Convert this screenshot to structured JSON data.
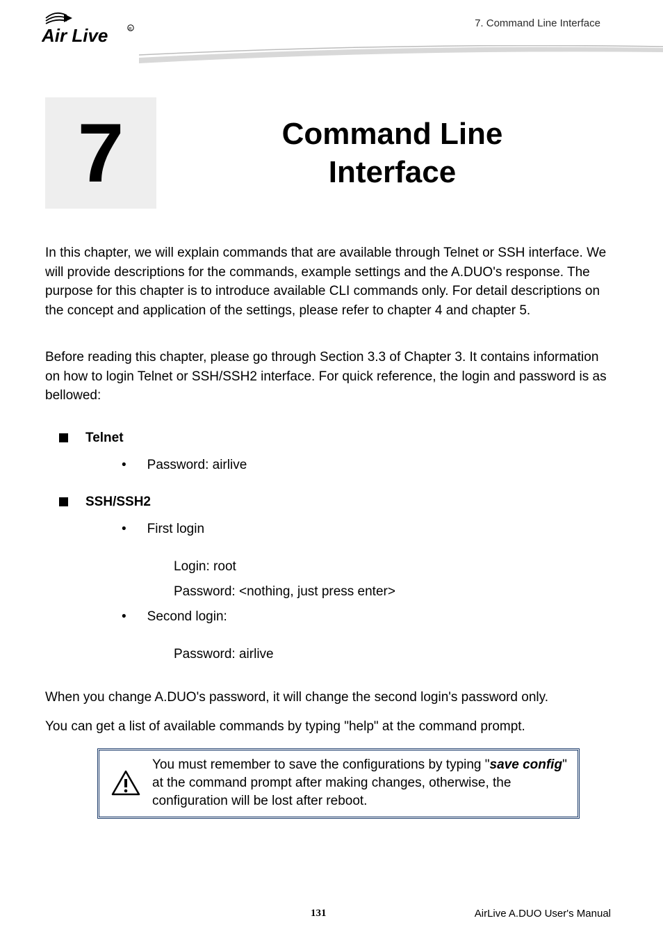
{
  "header": {
    "breadcrumb": "7. Command Line Interface"
  },
  "chapter": {
    "number": "7",
    "title_line1": "Command Line",
    "title_line2": "Interface"
  },
  "paragraphs": {
    "p1": "In this chapter, we will explain commands that are available through Telnet or SSH interface. We will provide descriptions for the commands, example settings and the A.DUO's response. The purpose for this chapter is to introduce available CLI commands only.   For detail descriptions on the concept and application of the settings, please refer to chapter 4 and chapter 5.",
    "p2": "Before reading this chapter, please go through Section 3.3 of Chapter 3. It contains information on how to login Telnet or SSH/SSH2 interface. For quick reference, the login and password is as bellowed:",
    "p3": "When you change A.DUO's password, it will change the second login's password only.",
    "p4": "You can get a list of available commands by typing \"help\" at the command prompt."
  },
  "sections": {
    "telnet": {
      "heading": "Telnet",
      "items": {
        "pw": "Password: airlive"
      }
    },
    "ssh": {
      "heading": "SSH/SSH2",
      "first": {
        "label": "First login",
        "login": "Login: root",
        "password": "Password: <nothing, just press enter>"
      },
      "second": {
        "label": "Second login:",
        "password": "Password: airlive"
      }
    }
  },
  "note": {
    "pre": "You must remember to save the configurations by typing \"",
    "cmd": "save config",
    "post": "\" at the command prompt after making changes, otherwise, the configuration will be lost after reboot."
  },
  "footer": {
    "page": "131",
    "manual": "AirLive A.DUO User's Manual"
  }
}
